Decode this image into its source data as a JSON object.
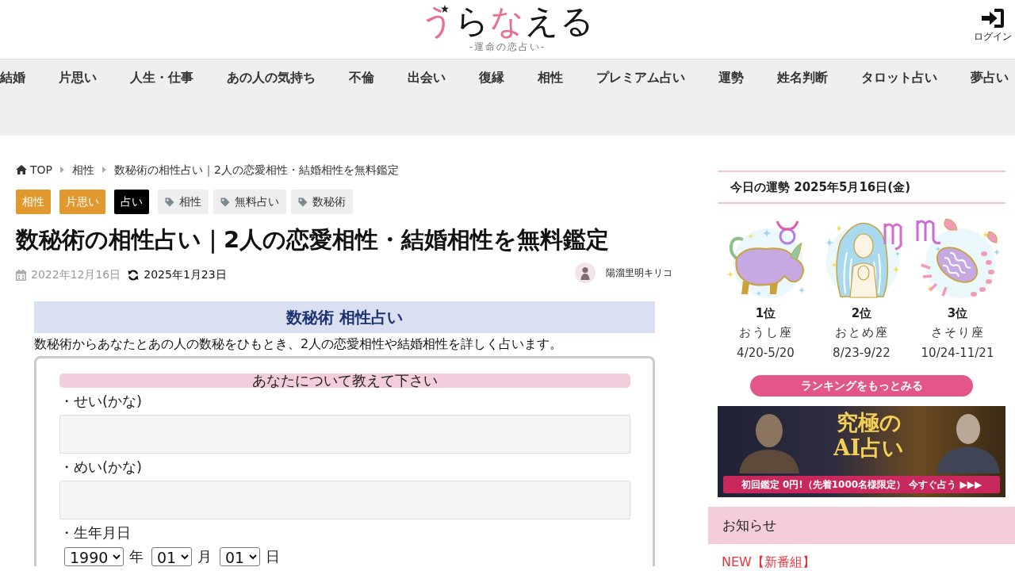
{
  "header": {
    "logo": "うらなえる",
    "tagline": "-運命の恋占い-",
    "login": "ログイン"
  },
  "nav": [
    "結婚",
    "片思い",
    "人生・仕事",
    "あの人の気持ち",
    "不倫",
    "出会い",
    "復縁",
    "相性",
    "プレミアム占い",
    "運勢",
    "姓名判断",
    "タロット占い",
    "夢占い"
  ],
  "breadcrumb": [
    "TOP",
    "相性",
    "数秘術の相性占い｜2人の恋愛相性・結婚相性を無料鑑定"
  ],
  "categories": [
    {
      "label": "相性",
      "color": "#e0982f"
    },
    {
      "label": "片思い",
      "color": "#e0982f"
    },
    {
      "label": "占い",
      "color": "#000000"
    }
  ],
  "tags": [
    "相性",
    "無料占い",
    "数秘術"
  ],
  "article": {
    "title": "数秘術の相性占い｜2人の恋愛相性・結婚相性を無料鑑定",
    "published": "2022年12月16日",
    "updated": "2025年1月23日",
    "author": "陽溜里明キリコ"
  },
  "form": {
    "heading": "数秘術 相性占い",
    "intro": "数秘術からあなたとあの人の数秘をひもとき、2人の恋愛相性や結婚相性を詳しく占います。",
    "section_title": "あなたについて教えて下さい",
    "fields": [
      {
        "kind": "text",
        "label": "・せい(かな)"
      },
      {
        "kind": "text",
        "label": "・めい(かな)"
      },
      {
        "kind": "date",
        "label": "・生年月日",
        "selects": [
          {
            "value": "1990",
            "unit": "年"
          },
          {
            "value": "01",
            "unit": "月"
          },
          {
            "value": "01",
            "unit": "日"
          }
        ]
      }
    ]
  },
  "sidebar": {
    "fortune_title": "今日の運勢 2025年5月16日(金)",
    "ranking": [
      {
        "kind": "bull",
        "rank": "1位",
        "sign": "おうし座",
        "dates": "4/20-5/20"
      },
      {
        "kind": "maiden",
        "rank": "2位",
        "sign": "おとめ座",
        "dates": "8/23-9/22"
      },
      {
        "kind": "scorpion",
        "rank": "3位",
        "sign": "さそり座",
        "dates": "10/24-11/21"
      }
    ],
    "more_button": "ランキングをもっとみる",
    "banner": {
      "headline": [
        "究極の",
        "AI占い"
      ],
      "strip": "初回鑑定 0円!（先着1000名様限定） 今すぐ占う ▶▶▶"
    },
    "notice": {
      "title": "お知らせ",
      "items": [
        "NEW【新番組】"
      ]
    }
  }
}
